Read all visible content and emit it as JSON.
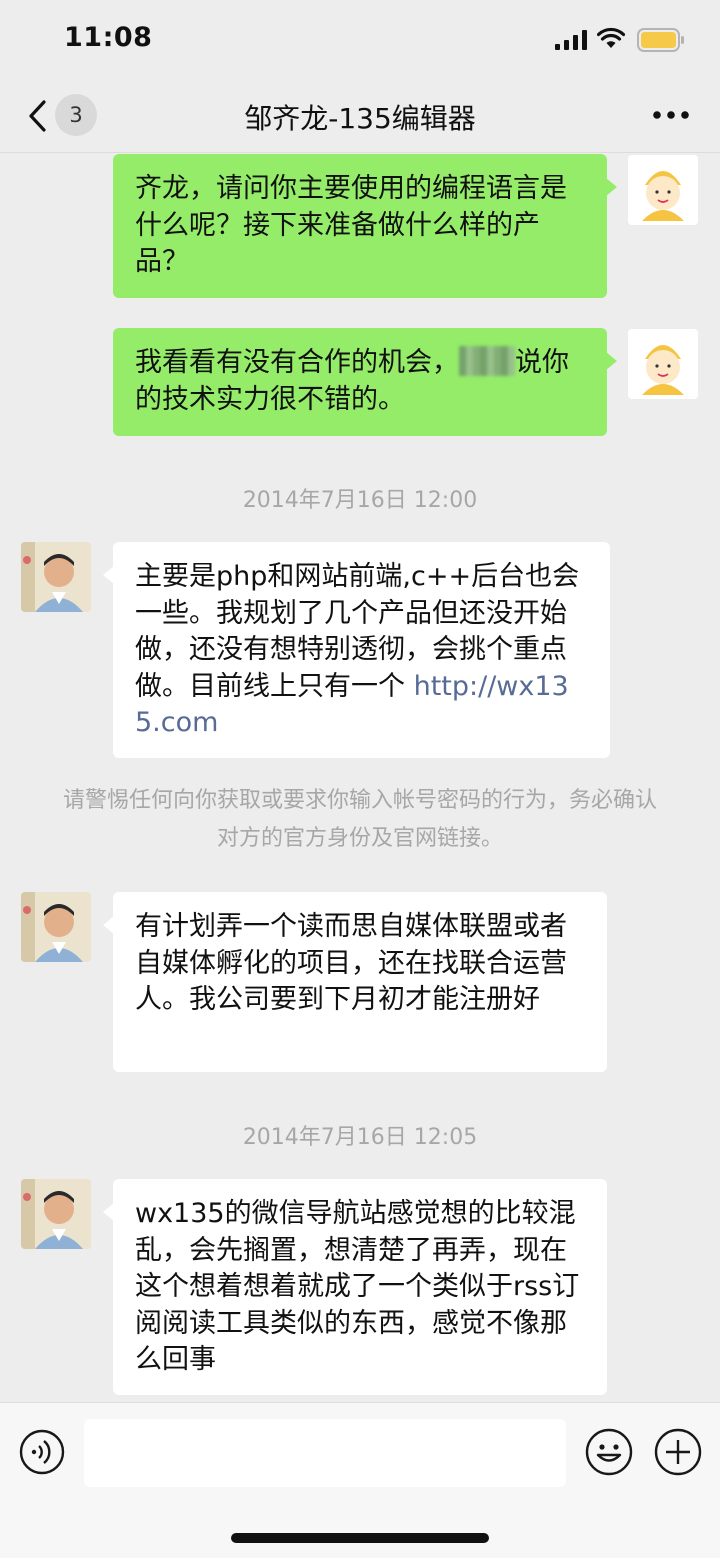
{
  "status": {
    "time": "11:08"
  },
  "nav": {
    "unread_count": "3",
    "title": "邹齐龙-135编辑器"
  },
  "messages": [
    {
      "side": "right",
      "text": "齐龙，请问你主要使用的编程语言是什么呢？接下来准备做什么样的产品？"
    },
    {
      "side": "right",
      "text_before": "我看看有没有合作的机会，",
      "text_after": "说你的技术实力很不错的。"
    },
    {
      "side": "left",
      "text": "主要是php和网站前端,c++后台也会一些。我规划了几个产品但还没开始做，还没有想特别透彻，会挑个重点做。目前线上只有一个",
      "link": "http://wx135.com"
    },
    {
      "side": "left",
      "text": "有计划弄一个读而思自媒体联盟或者自媒体孵化的项目，还在找联合运营人。我公司要到下月初才能注册好"
    },
    {
      "side": "left",
      "text": "wx135的微信导航站感觉想的比较混乱，会先搁置，想清楚了再弄，现在这个想着想着就成了一个类似于rss订阅阅读工具类似的东西，感觉不像那么回事"
    }
  ],
  "timestamps": [
    "2014年7月16日 12:00",
    "2014年7月16日 12:05"
  ],
  "security_notice": "请警惕任何向你获取或要求你输入帐号密码的行为，务必确认对方的官方身份及官网链接。",
  "input": {
    "value": "",
    "placeholder": ""
  },
  "icons": {
    "back": "back-chevron-icon",
    "more": "more-dots-icon",
    "voice": "voice-icon",
    "emoji": "emoji-icon",
    "plus": "plus-icon"
  },
  "colors": {
    "background": "#ededed",
    "own_bubble": "#95ec69",
    "other_bubble": "#ffffff",
    "link": "#576b95",
    "battery": "#f7c948"
  }
}
